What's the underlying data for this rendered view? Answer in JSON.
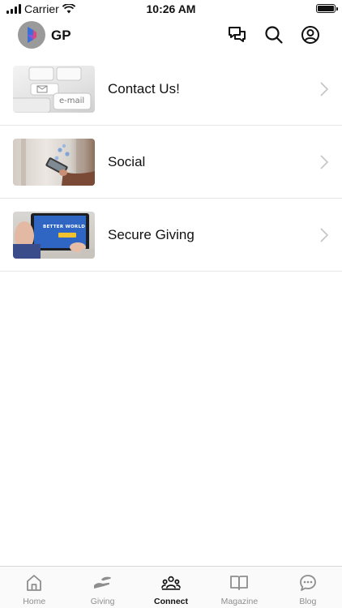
{
  "status": {
    "carrier": "Carrier",
    "time": "10:26 AM"
  },
  "header": {
    "brand": "GP",
    "icons": [
      "chat-icon",
      "search-icon",
      "profile-icon"
    ]
  },
  "list": {
    "items": [
      {
        "label": "Contact Us!",
        "thumb_text": "e-mail"
      },
      {
        "label": "Social"
      },
      {
        "label": "Secure Giving",
        "thumb_text": "BETTER WORLD"
      }
    ]
  },
  "tabbar": {
    "active": "Connect",
    "tabs": [
      {
        "label": "Home",
        "icon": "home-icon"
      },
      {
        "label": "Giving",
        "icon": "giving-hand-icon"
      },
      {
        "label": "Connect",
        "icon": "people-icon"
      },
      {
        "label": "Magazine",
        "icon": "book-icon"
      },
      {
        "label": "Blog",
        "icon": "chat-bubble-icon"
      }
    ]
  },
  "colors": {
    "text": "#111111",
    "inactive": "#8e8e8e",
    "divider": "#e6e6e6",
    "avatar_bg": "#9a9a9a",
    "logo_blue": "#3a6fd8",
    "logo_pink": "#e0457b"
  }
}
